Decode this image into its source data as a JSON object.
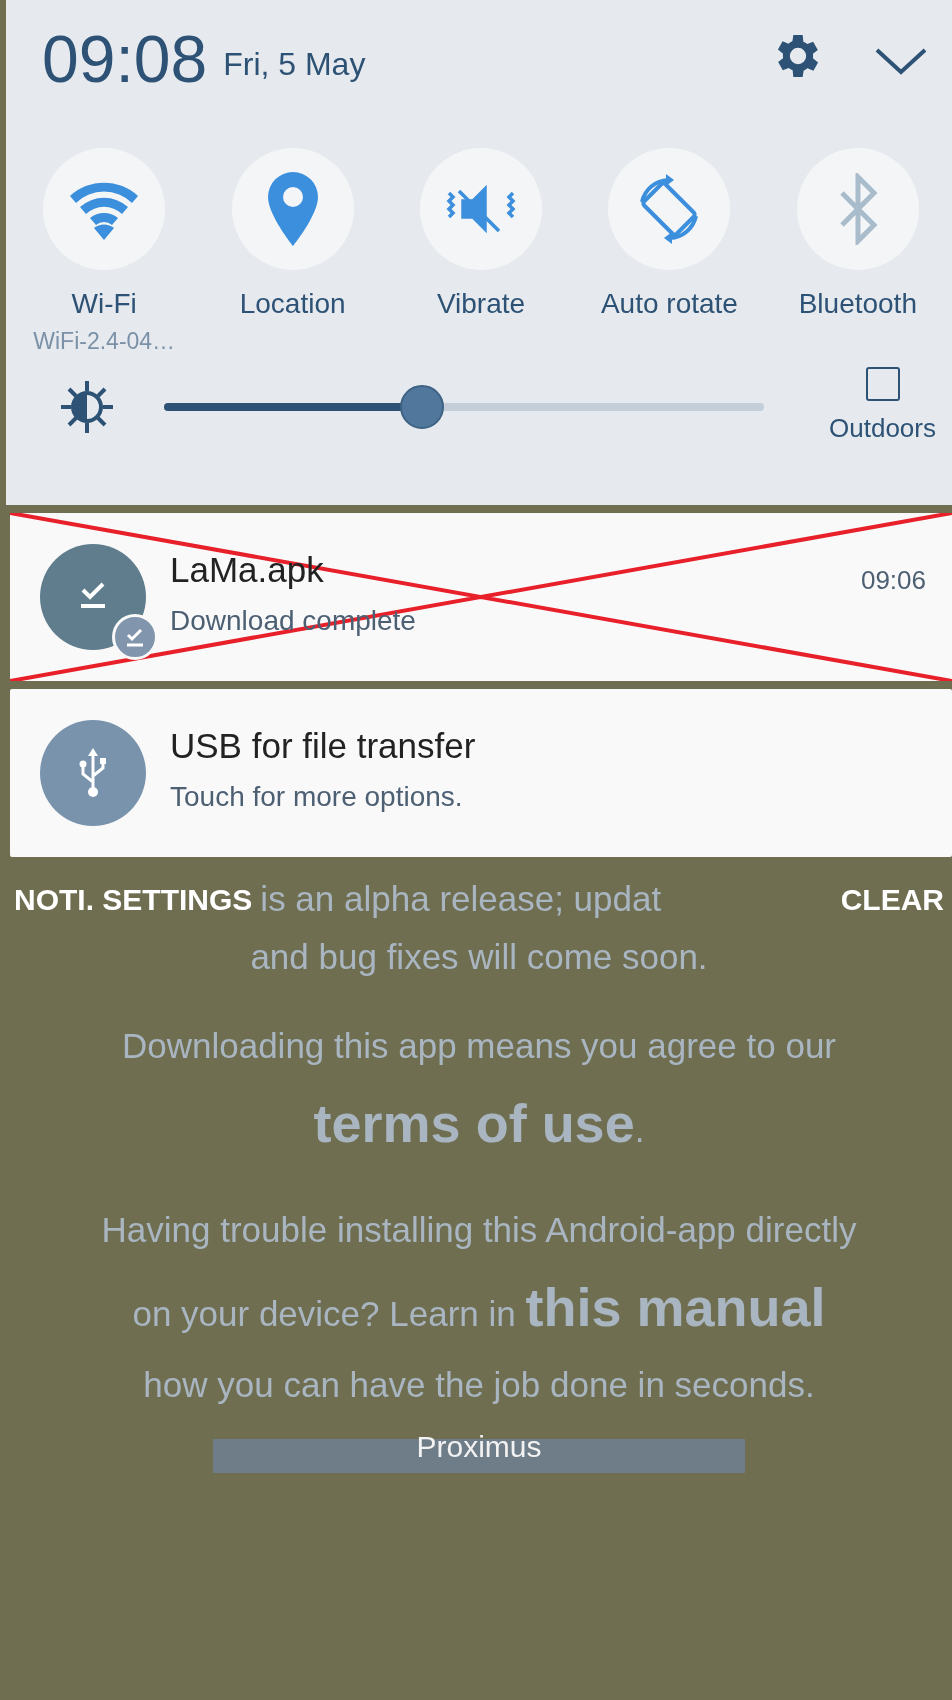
{
  "header": {
    "time": "09:08",
    "date": "Fri, 5 May"
  },
  "tiles": [
    {
      "kind": "wifi",
      "label": "Wi-Fi",
      "sublabel": "WiFi-2.4-04…",
      "on": true
    },
    {
      "kind": "location",
      "label": "Location",
      "on": true
    },
    {
      "kind": "vibrate",
      "label": "Vibrate",
      "on": true
    },
    {
      "kind": "rotate",
      "label": "Auto rotate",
      "on": true
    },
    {
      "kind": "bluetooth",
      "label": "Bluetooth",
      "on": false
    }
  ],
  "brightness": {
    "level": 0.43,
    "outdoors": {
      "label": "Outdoors",
      "checked": false
    }
  },
  "notifications": [
    {
      "kind": "download",
      "title": "LaMa.apk",
      "text": "Download complete",
      "time": "09:06",
      "crossed_out": true
    },
    {
      "kind": "usb",
      "title": "USB for file transfer",
      "text": "Touch for more options.",
      "crossed_out": false
    }
  ],
  "shade_actions": {
    "left": "NOTI. SETTINGS",
    "right": "CLEAR"
  },
  "page": {
    "fragment": "is an alpha release; updat",
    "paragraphs": [
      "and bug fixes will come soon.",
      "Downloading this app means you agree to our **terms of use**.",
      "Having trouble installing this Android-app directly on your device? Learn in **this manual** how you can have the job done in seconds."
    ],
    "carrier": "Proximus"
  }
}
